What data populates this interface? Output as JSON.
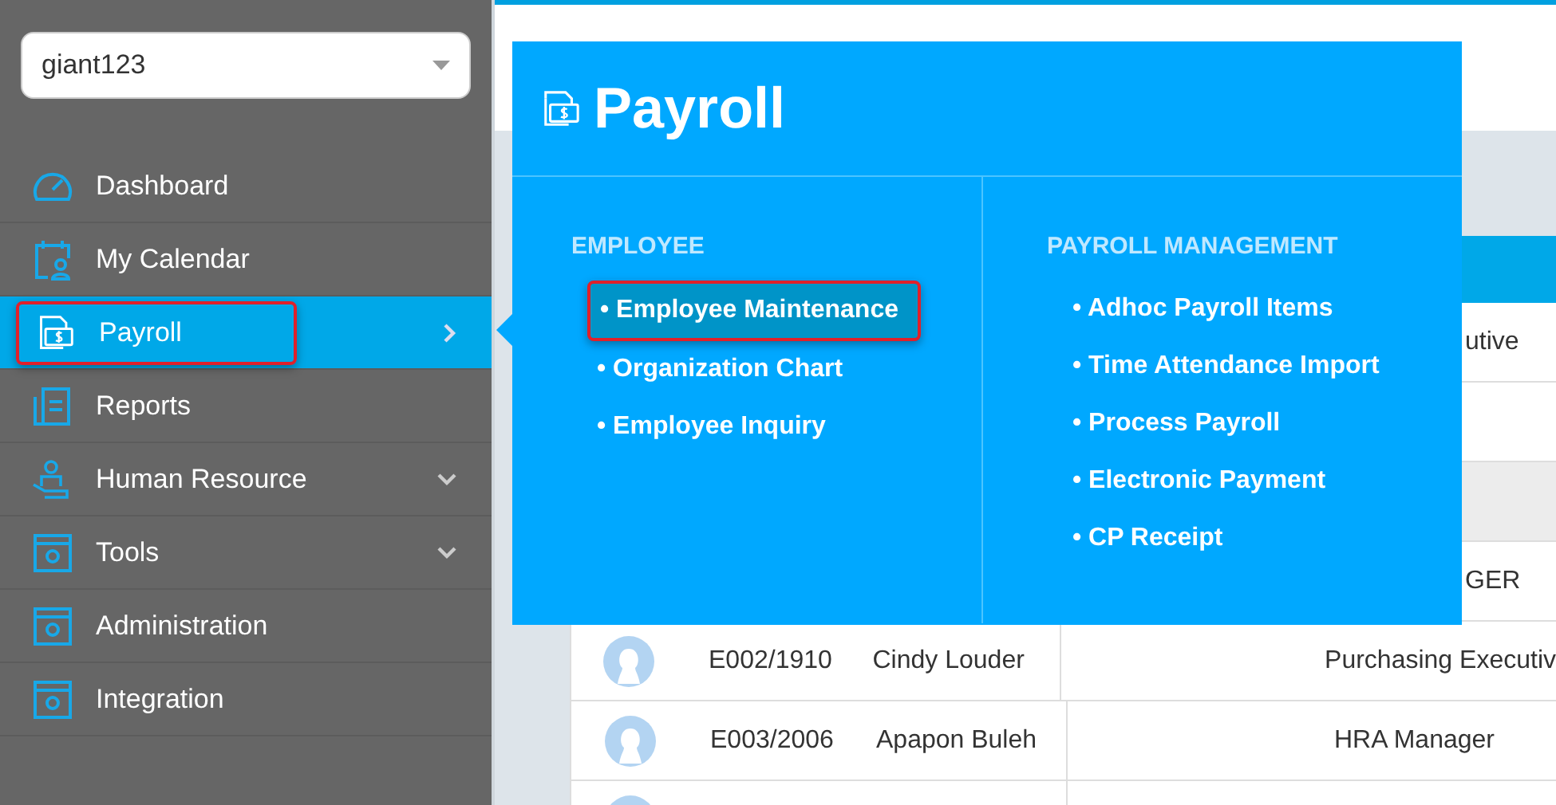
{
  "account_select": {
    "value": "giant123"
  },
  "sidebar": {
    "items": [
      {
        "label": "Dashboard",
        "selected": false,
        "kind": "link"
      },
      {
        "label": "My Calendar",
        "selected": false,
        "kind": "link"
      },
      {
        "label": "Payroll",
        "selected": true,
        "kind": "flyout"
      },
      {
        "label": "Reports",
        "selected": false,
        "kind": "link"
      },
      {
        "label": "Human Resource",
        "selected": false,
        "kind": "collapsible"
      },
      {
        "label": "Tools",
        "selected": false,
        "kind": "collapsible"
      },
      {
        "label": "Administration",
        "selected": false,
        "kind": "link"
      },
      {
        "label": "Integration",
        "selected": false,
        "kind": "link"
      }
    ]
  },
  "mega_menu": {
    "title": "Payroll",
    "columns": [
      {
        "heading": "EMPLOYEE",
        "items": [
          {
            "label": "• Employee Maintenance",
            "selected": true
          },
          {
            "label": "• Organization Chart",
            "selected": false
          },
          {
            "label": "• Employee Inquiry",
            "selected": false
          }
        ]
      },
      {
        "heading": "PAYROLL MANAGEMENT",
        "items": [
          {
            "label": "• Adhoc Payroll Items",
            "selected": false
          },
          {
            "label": "• Time Attendance Import",
            "selected": false
          },
          {
            "label": "• Process Payroll",
            "selected": false
          },
          {
            "label": "• Electronic Payment",
            "selected": false
          },
          {
            "label": "• CP Receipt",
            "selected": false
          }
        ]
      }
    ]
  },
  "table": {
    "rows": [
      {
        "kind": "covered",
        "designation": "utive"
      },
      {
        "kind": "covered",
        "designation": ""
      },
      {
        "kind": "band",
        "designation": ""
      },
      {
        "kind": "covered",
        "designation": "GER"
      },
      {
        "kind": "employee",
        "code": "E002/1910",
        "name": "Cindy Louder",
        "designation": "Purchasing Executiv"
      },
      {
        "kind": "employee",
        "code": "E003/2006",
        "name": "Apapon Buleh",
        "designation": "HRA Manager"
      },
      {
        "kind": "employee",
        "code": "",
        "name": "",
        "designation": ""
      }
    ]
  }
}
